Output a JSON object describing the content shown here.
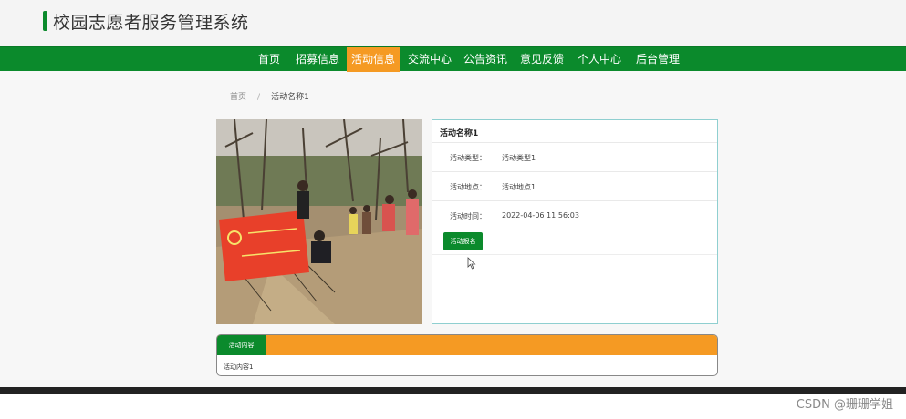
{
  "app": {
    "title": "校园志愿者服务管理系统"
  },
  "nav": {
    "items": [
      {
        "label": "首页"
      },
      {
        "label": "招募信息"
      },
      {
        "label": "活动信息"
      },
      {
        "label": "交流中心"
      },
      {
        "label": "公告资讯"
      },
      {
        "label": "意见反馈"
      },
      {
        "label": "个人中心"
      },
      {
        "label": "后台管理"
      }
    ],
    "active_index": 2
  },
  "breadcrumb": {
    "home": "首页",
    "separator": "/",
    "current": "活动名称1"
  },
  "activity": {
    "name": "活动名称1",
    "type_label": "活动类型：",
    "type_value": "活动类型1",
    "location_label": "活动地点：",
    "location_value": "活动地点1",
    "time_label": "活动时间：",
    "time_value": "2022-04-06 11:56:03",
    "signup_button": "活动报名"
  },
  "content": {
    "tab_label": "活动内容",
    "text": "活动内容1"
  },
  "watermark": "CSDN @珊珊学姐",
  "colors": {
    "primary_green": "#0b8a2c",
    "accent_orange": "#f59a23",
    "detail_border": "#8fcfd0"
  }
}
